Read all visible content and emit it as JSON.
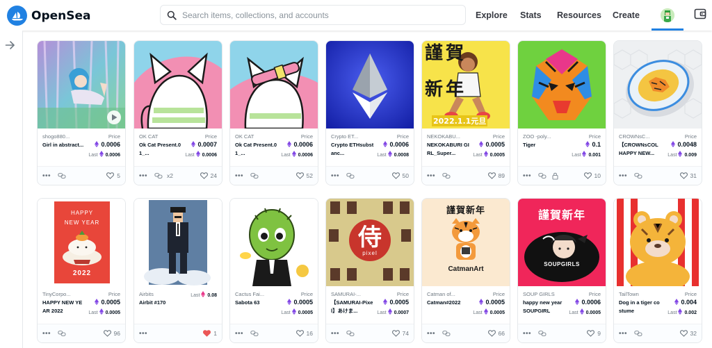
{
  "app": {
    "name": "OpenSea"
  },
  "search": {
    "placeholder": "Search items, collections, and accounts"
  },
  "nav": {
    "explore": "Explore",
    "stats": "Stats",
    "resources": "Resources",
    "create": "Create"
  },
  "labels": {
    "price": "Price",
    "last": "Last"
  },
  "colors": {
    "accent": "#2081e2",
    "liked": "#eb5757"
  },
  "cards": [
    {
      "collection": "shogo880...",
      "name": "Girl in abstract...",
      "price": "0.0006",
      "last": "0.0006",
      "likes": "5"
    },
    {
      "collection": "OK CAT",
      "name": "Ok Cat Present.01_...",
      "price": "0.0007",
      "last": "0.0006",
      "likes": "24",
      "extra": "x2"
    },
    {
      "collection": "OK CAT",
      "name": "Ok Cat Present.01_...",
      "price": "0.0006",
      "last": "0.0006",
      "likes": "52"
    },
    {
      "collection": "Crypto ET...",
      "name": "Crypto ETHsubstanc...",
      "price": "0.0006",
      "last": "0.0008",
      "likes": "50"
    },
    {
      "collection": "NEKOKABU...",
      "name": "NEKOKABURI GIRL_Super...",
      "price": "0.0005",
      "last": "0.0005",
      "likes": "89"
    },
    {
      "collection": "ZOO -poly...",
      "name": "Tiger",
      "price": "0.1",
      "last": "0.001",
      "likes": "10"
    },
    {
      "collection": "CROWNsC...",
      "name": "【CROWNsCOL HAPPY NEW...",
      "price": "0.0048",
      "last": "0.009",
      "likes": "31"
    },
    {
      "collection": "TinyCorpo...",
      "name": "HAPPY NEW YEAR 2022",
      "price": "0.0005",
      "last": "0.0005",
      "likes": "96"
    },
    {
      "collection": "Airbits",
      "name": "Airbit #170",
      "price": "",
      "last": "0.08",
      "likes": "1"
    },
    {
      "collection": "Cactus Fai...",
      "name": "Sabota 63",
      "price": "0.0005",
      "last": "0.0005",
      "likes": "16"
    },
    {
      "collection": "SAMURAI-...",
      "name": "【SAMURAI-Pixel】あけま...",
      "price": "0.0005",
      "last": "0.0007",
      "likes": "74"
    },
    {
      "collection": "Catman of...",
      "name": "Catman#2022",
      "price": "0.0005",
      "last": "0.0005",
      "likes": "66"
    },
    {
      "collection": "SOUP GIRLS",
      "name": "happy new year SOUPGIRL",
      "price": "0.0006",
      "last": "0.0005",
      "likes": "9"
    },
    {
      "collection": "TailTown",
      "name": "Dog in a tiger costume",
      "price": "0.004",
      "last": "0.002",
      "likes": "32"
    }
  ],
  "artwork_text": {
    "nekokaburi_top": "謹賀",
    "nekokaburi_bottom": "新年",
    "nekokaburi_date": "2022.1.1元旦",
    "tiny_line1": "HAPPY",
    "tiny_line2": "NEW YEAR",
    "tiny_year": "2022",
    "samurai_kanji": "侍",
    "samurai_pixel": "pixel",
    "catman_title": "謹賀新年",
    "catman_brand": "CatmanArt",
    "soup_title": "謹賀新年",
    "soup_brand": "SOUPGIRLS"
  }
}
